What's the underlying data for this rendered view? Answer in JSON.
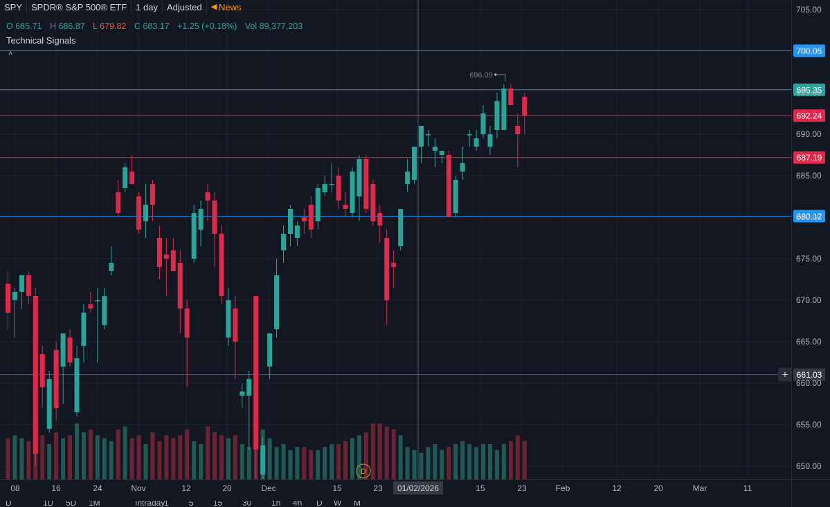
{
  "header": {
    "symbol": "SPY",
    "name": "SPDR® S&P 500® ETF",
    "interval": "1 day",
    "adjustment": "Adjusted",
    "news": "News"
  },
  "ohlc": {
    "o_label": "O",
    "o": "685.71",
    "h_label": "H",
    "h": "686.87",
    "l_label": "L",
    "l": "679.82",
    "c_label": "C",
    "c": "683.17",
    "change": "+1.25 (+0.18%)",
    "vol_label": "Vol",
    "vol": "89,377,203"
  },
  "technical_signals": "Technical Signals",
  "crosshair_marker": "D",
  "bottom_toolbar": [
    "D",
    "1D",
    "5D",
    "1M",
    "Intraday",
    "1",
    "5",
    "15",
    "30",
    "1h",
    "4h",
    "D",
    "W",
    "M"
  ],
  "colors": {
    "background": "#131722",
    "up": "#26a69a",
    "down": "#e0294a",
    "line_blue": "#2196f3",
    "line_green": "#26a69a",
    "line_red": "#e0294a",
    "crosshair": "#787b86",
    "grid": "#1e2230"
  },
  "chart_data": {
    "type": "candlestick",
    "ylim": [
      648,
      707
    ],
    "y_ticks": [
      "650.00",
      "655.00",
      "660.00",
      "665.00",
      "670.00",
      "675.00",
      "680.00",
      "685.00",
      "690.00",
      "695.00",
      "700.00",
      "705.00"
    ],
    "x_ticks": [
      "08",
      "16",
      "24",
      "Nov",
      "12",
      "20",
      "Dec",
      "15",
      "23",
      "01/02/2026",
      "15",
      "23",
      "Feb",
      "12",
      "20",
      "Mar",
      "11"
    ],
    "crosshair_date": "01/02/2026",
    "horizontal_lines": [
      {
        "value": 700.05,
        "label": "700.05",
        "color": "blue"
      },
      {
        "value": 695.35,
        "label": "695.35",
        "color": "green"
      },
      {
        "value": 692.24,
        "label": "692.24",
        "color": "red"
      },
      {
        "value": 687.19,
        "label": "687.19",
        "color": "red"
      },
      {
        "value": 680.12,
        "label": "680.12",
        "color": "blue"
      },
      {
        "value": 661.03,
        "label": "661.03",
        "color": "gray"
      }
    ],
    "high_annotation": {
      "value": 696.09,
      "label": "696.09"
    },
    "candles": [
      {
        "o": 672.0,
        "h": 673.5,
        "l": 666.5,
        "c": 668.5
      },
      {
        "o": 670.0,
        "h": 671.5,
        "l": 665.5,
        "c": 671.0
      },
      {
        "o": 671.0,
        "h": 673.0,
        "l": 669.0,
        "c": 673.0
      },
      {
        "o": 673.0,
        "h": 673.5,
        "l": 669.5,
        "c": 670.5
      },
      {
        "o": 670.5,
        "h": 671.5,
        "l": 650.0,
        "c": 651.5
      },
      {
        "o": 663.5,
        "h": 664.5,
        "l": 657.0,
        "c": 659.5
      },
      {
        "o": 654.5,
        "h": 661.5,
        "l": 654.0,
        "c": 660.5
      },
      {
        "o": 664.0,
        "h": 665.0,
        "l": 655.5,
        "c": 657.0
      },
      {
        "o": 662.0,
        "h": 665.5,
        "l": 657.5,
        "c": 666.0
      },
      {
        "o": 665.5,
        "h": 666.5,
        "l": 662.0,
        "c": 662.5
      },
      {
        "o": 656.5,
        "h": 664.5,
        "l": 656.0,
        "c": 663.0
      },
      {
        "o": 664.5,
        "h": 669.5,
        "l": 662.5,
        "c": 668.5
      },
      {
        "o": 669.5,
        "h": 671.0,
        "l": 668.5,
        "c": 669.0
      },
      {
        "o": 670.0,
        "h": 671.5,
        "l": 662.5,
        "c": 670.0
      },
      {
        "o": 667.0,
        "h": 671.5,
        "l": 666.5,
        "c": 670.5
      },
      {
        "o": 673.5,
        "h": 676.5,
        "l": 673.0,
        "c": 674.5
      },
      {
        "o": 683.0,
        "h": 684.5,
        "l": 680.0,
        "c": 680.5
      },
      {
        "o": 683.5,
        "h": 686.5,
        "l": 683.0,
        "c": 686.0
      },
      {
        "o": 685.5,
        "h": 687.5,
        "l": 684.5,
        "c": 684.0
      },
      {
        "o": 682.5,
        "h": 683.0,
        "l": 678.0,
        "c": 678.5
      },
      {
        "o": 679.5,
        "h": 684.0,
        "l": 677.5,
        "c": 681.5
      },
      {
        "o": 684.0,
        "h": 684.5,
        "l": 679.5,
        "c": 681.5
      },
      {
        "o": 677.5,
        "h": 679.0,
        "l": 672.5,
        "c": 674.0
      },
      {
        "o": 675.5,
        "h": 677.5,
        "l": 670.5,
        "c": 675.0
      },
      {
        "o": 676.0,
        "h": 677.5,
        "l": 673.5,
        "c": 673.5
      },
      {
        "o": 674.5,
        "h": 676.0,
        "l": 666.0,
        "c": 669.0
      },
      {
        "o": 669.0,
        "h": 670.0,
        "l": 659.5,
        "c": 665.5
      },
      {
        "o": 675.0,
        "h": 681.5,
        "l": 674.5,
        "c": 680.5
      },
      {
        "o": 678.5,
        "h": 682.0,
        "l": 676.5,
        "c": 681.0
      },
      {
        "o": 683.0,
        "h": 684.0,
        "l": 679.5,
        "c": 682.0
      },
      {
        "o": 682.0,
        "h": 683.0,
        "l": 674.0,
        "c": 678.0
      },
      {
        "o": 678.0,
        "h": 679.0,
        "l": 669.5,
        "c": 670.5
      },
      {
        "o": 665.5,
        "h": 671.5,
        "l": 664.5,
        "c": 670.0
      },
      {
        "o": 669.0,
        "h": 670.5,
        "l": 660.5,
        "c": 665.0
      },
      {
        "o": 658.5,
        "h": 660.0,
        "l": 657.0,
        "c": 659.0
      },
      {
        "o": 658.5,
        "h": 661.5,
        "l": 652.0,
        "c": 660.5
      },
      {
        "o": 670.5,
        "h": 670.5,
        "l": 648.5,
        "c": 652.0
      },
      {
        "o": 649.0,
        "h": 653.5,
        "l": 648.5,
        "c": 652.5
      },
      {
        "o": 662.0,
        "h": 666.0,
        "l": 660.5,
        "c": 666.0
      },
      {
        "o": 666.5,
        "h": 675.0,
        "l": 665.5,
        "c": 673.0
      },
      {
        "o": 676.0,
        "h": 679.0,
        "l": 674.5,
        "c": 678.0
      },
      {
        "o": 678.0,
        "h": 681.5,
        "l": 676.5,
        "c": 681.0
      },
      {
        "o": 677.5,
        "h": 679.5,
        "l": 676.5,
        "c": 679.0
      },
      {
        "o": 680.0,
        "h": 681.0,
        "l": 678.0,
        "c": 679.5
      },
      {
        "o": 681.5,
        "h": 682.5,
        "l": 677.5,
        "c": 678.5
      },
      {
        "o": 679.5,
        "h": 684.0,
        "l": 678.5,
        "c": 683.5
      },
      {
        "o": 683.0,
        "h": 685.0,
        "l": 682.5,
        "c": 684.0
      },
      {
        "o": 684.0,
        "h": 686.5,
        "l": 683.0,
        "c": 684.0
      },
      {
        "o": 685.0,
        "h": 686.0,
        "l": 681.0,
        "c": 682.0
      },
      {
        "o": 681.5,
        "h": 683.0,
        "l": 680.0,
        "c": 681.0
      },
      {
        "o": 680.5,
        "h": 686.0,
        "l": 680.0,
        "c": 685.5
      },
      {
        "o": 682.5,
        "h": 687.5,
        "l": 679.5,
        "c": 687.0
      },
      {
        "o": 687.0,
        "h": 687.5,
        "l": 680.5,
        "c": 681.0
      },
      {
        "o": 684.0,
        "h": 684.5,
        "l": 679.0,
        "c": 679.5
      },
      {
        "o": 680.5,
        "h": 681.5,
        "l": 677.0,
        "c": 679.0
      },
      {
        "o": 677.5,
        "h": 678.5,
        "l": 667.0,
        "c": 670.0
      },
      {
        "o": 674.5,
        "h": 676.0,
        "l": 671.5,
        "c": 674.0
      },
      {
        "o": 676.5,
        "h": 681.0,
        "l": 676.0,
        "c": 681.0
      },
      {
        "o": 684.0,
        "h": 687.0,
        "l": 683.0,
        "c": 685.5
      },
      {
        "o": 684.5,
        "h": 688.5,
        "l": 684.0,
        "c": 688.5
      },
      {
        "o": 688.5,
        "h": 690.5,
        "l": 686.5,
        "c": 691.0
      },
      {
        "o": 690.0,
        "h": 690.5,
        "l": 688.5,
        "c": 690.0
      },
      {
        "o": 688.0,
        "h": 689.5,
        "l": 686.0,
        "c": 688.5
      },
      {
        "o": 687.5,
        "h": 688.0,
        "l": 686.5,
        "c": 688.0
      },
      {
        "o": 687.5,
        "h": 688.0,
        "l": 681.0,
        "c": 680.0
      },
      {
        "o": 680.5,
        "h": 685.0,
        "l": 680.0,
        "c": 684.5
      },
      {
        "o": 685.5,
        "h": 688.5,
        "l": 684.5,
        "c": 686.5
      },
      {
        "o": 690.0,
        "h": 690.5,
        "l": 688.5,
        "c": 690.0
      },
      {
        "o": 688.5,
        "h": 690.5,
        "l": 688.0,
        "c": 689.5
      },
      {
        "o": 690.0,
        "h": 693.5,
        "l": 689.5,
        "c": 692.5
      },
      {
        "o": 688.5,
        "h": 691.0,
        "l": 687.5,
        "c": 690.0
      },
      {
        "o": 690.5,
        "h": 695.0,
        "l": 689.5,
        "c": 694.0
      },
      {
        "o": 690.5,
        "h": 696.0,
        "l": 690.5,
        "c": 695.5
      },
      {
        "o": 695.5,
        "h": 696.09,
        "l": 693.5,
        "c": 693.5
      },
      {
        "o": 691.0,
        "h": 692.5,
        "l": 686.0,
        "c": 690.0
      },
      {
        "o": 694.5,
        "h": 695.0,
        "l": 690.0,
        "c": 692.24
      }
    ],
    "volume_relative": [
      0.7,
      0.75,
      0.7,
      0.65,
      0.9,
      0.75,
      0.6,
      0.8,
      0.7,
      0.75,
      0.95,
      0.8,
      0.85,
      0.75,
      0.7,
      0.65,
      0.85,
      0.9,
      0.7,
      0.75,
      0.6,
      0.8,
      0.65,
      0.75,
      0.7,
      0.75,
      0.85,
      0.65,
      0.6,
      0.9,
      0.8,
      0.75,
      0.7,
      0.75,
      0.6,
      0.55,
      0.85,
      0.85,
      0.7,
      0.55,
      0.6,
      0.5,
      0.55,
      0.55,
      0.5,
      0.5,
      0.55,
      0.6,
      0.6,
      0.65,
      0.7,
      0.75,
      0.8,
      0.95,
      0.95,
      0.9,
      0.85,
      0.75,
      0.55,
      0.5,
      0.45,
      0.55,
      0.6,
      0.5,
      0.55,
      0.6,
      0.65,
      0.6,
      0.55,
      0.6,
      0.6,
      0.5,
      0.6,
      0.65,
      0.75,
      0.65
    ]
  }
}
